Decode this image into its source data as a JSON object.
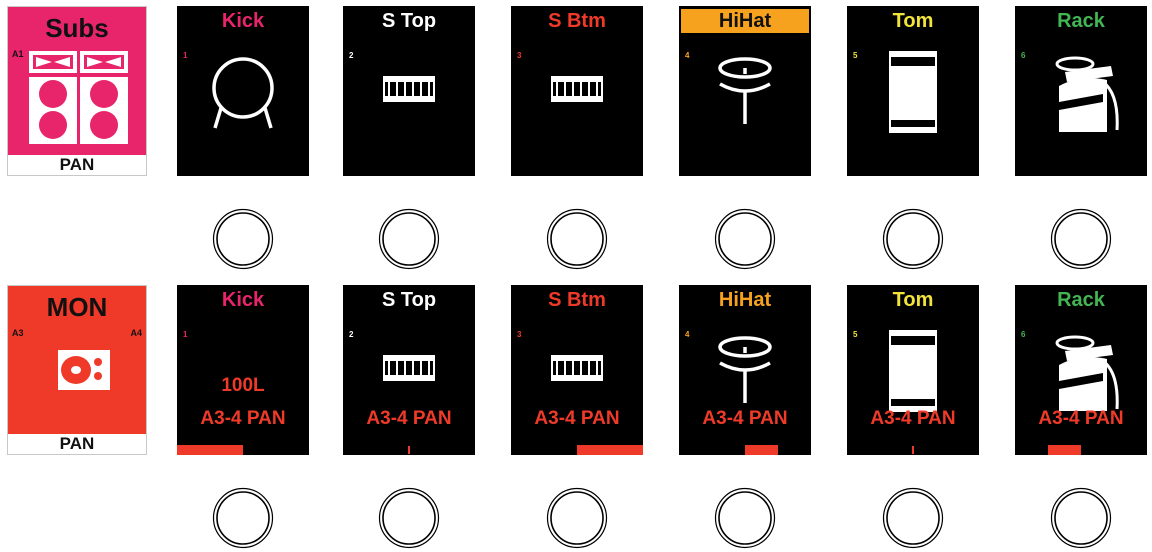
{
  "colors": {
    "subs_bg": "#e8246b",
    "mon_bg": "#ef3a2a",
    "strip_bg": "#000000",
    "accent_red": "#ef3a2a"
  },
  "selectors": [
    {
      "title": "Subs",
      "tag_left": "A1",
      "tag_right": "",
      "mode": "PAN",
      "icon": "speaker-stack-icon"
    },
    {
      "title": "MON",
      "tag_left": "A3",
      "tag_right": "A4",
      "mode": "PAN",
      "icon": "wedge-monitor-icon"
    }
  ],
  "channels": [
    {
      "name": "Kick",
      "number": "1",
      "color": "#e8246b",
      "highlight": false,
      "icon": "kick-drum-icon"
    },
    {
      "name": "S Top",
      "number": "2",
      "color": "#ffffff",
      "highlight": false,
      "icon": "snare-drum-icon"
    },
    {
      "name": "S Btm",
      "number": "3",
      "color": "#ef3a2a",
      "highlight": false,
      "icon": "snare-drum-icon"
    },
    {
      "name": "HiHat",
      "number": "4",
      "color": "#f7a21e",
      "highlight": true,
      "icon": "hihat-icon"
    },
    {
      "name": "Tom",
      "number": "5",
      "color": "#f2e33a",
      "highlight": false,
      "icon": "tom-drum-icon"
    },
    {
      "name": "Rack",
      "number": "6",
      "color": "#41b653",
      "highlight": false,
      "icon": "cymbal-rack-icon"
    }
  ],
  "mon_row": {
    "param_label": "A3-4 PAN",
    "values": [
      "100L",
      "",
      "",
      "",
      "",
      ""
    ],
    "pan": [
      -100,
      0,
      100,
      50,
      0,
      -50
    ]
  }
}
